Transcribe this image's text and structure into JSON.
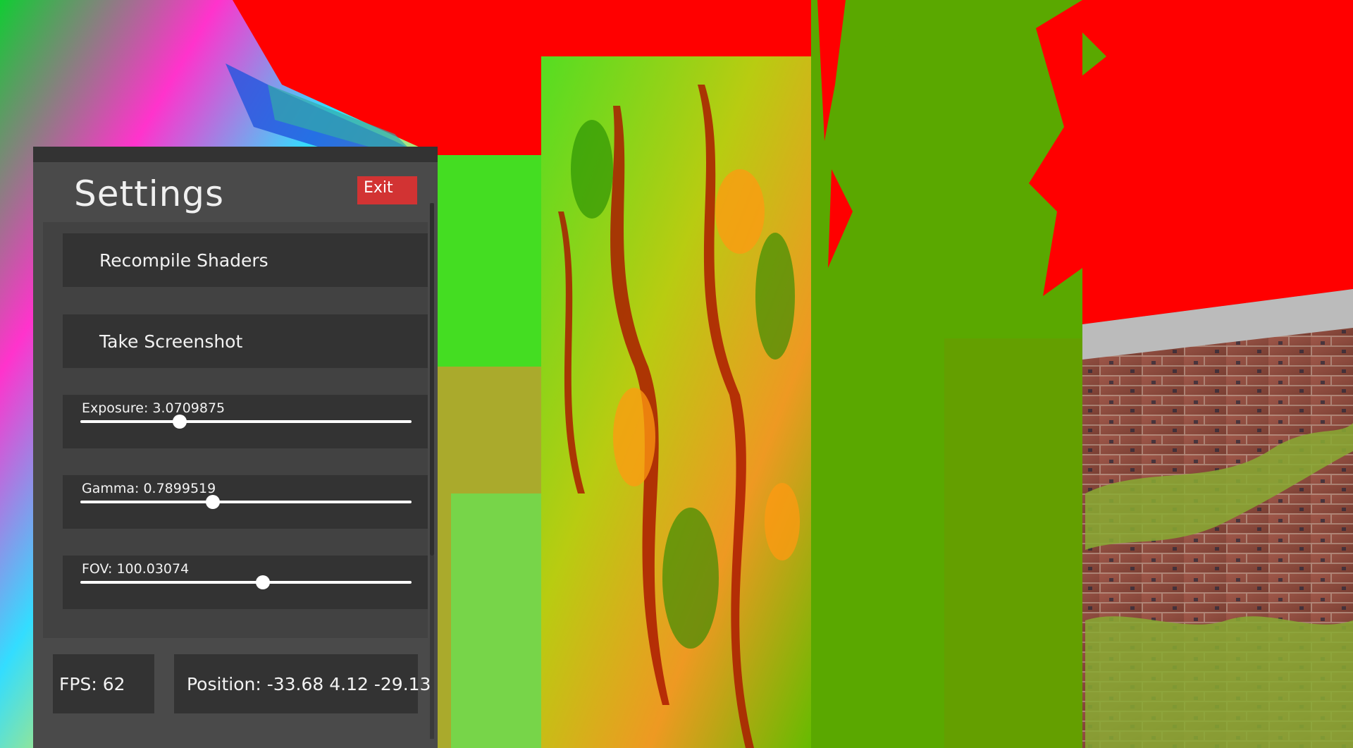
{
  "settings": {
    "title": "Settings",
    "exit_label": "Exit",
    "recompile_label": "Recompile Shaders",
    "screenshot_label": "Take Screenshot",
    "sliders": [
      {
        "label": "Exposure: 3.0709875",
        "level": 0.3
      },
      {
        "label": "Gamma: 0.7899519",
        "level": 0.4
      },
      {
        "label": "FOV: 100.03074",
        "level": 0.55
      }
    ]
  },
  "stats": {
    "fps": "FPS: 62",
    "position": "Position: -33.68 4.12 -29.13"
  },
  "colors": {
    "sky": "#ff0000",
    "panel_bg": "#4a4a4a",
    "card_bg": "#333333",
    "exit_bg": "#d23333",
    "foliage_green": "#5aa800",
    "brick": "#8b4a3c"
  }
}
